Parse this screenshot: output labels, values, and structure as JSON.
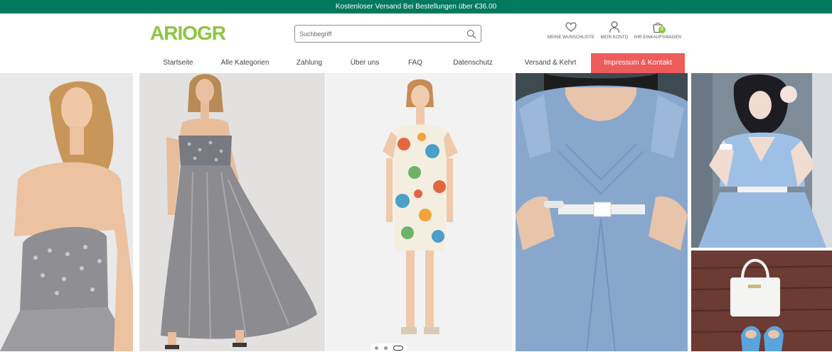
{
  "promo_bar": {
    "text": "Kostenloser Versand Bei Bestellungen über €36.00"
  },
  "header": {
    "logo": "ARIOGR",
    "search": {
      "placeholder": "Suchbegriff",
      "value": ""
    },
    "actions": {
      "wishlist": {
        "label": "MEINE WUNSCHLISTE",
        "icon": "heart-icon"
      },
      "account": {
        "label": "MEIN KONTO",
        "icon": "user-icon"
      },
      "cart": {
        "label": "IHR EINKAUFSWAGEN",
        "count": "0",
        "icon": "shopping-bag-icon"
      }
    }
  },
  "nav": {
    "items": [
      {
        "label": "Startseite"
      },
      {
        "label": "Alle Kategorien "
      },
      {
        "label": "Zahlung"
      },
      {
        "label": "Über uns"
      },
      {
        "label": "FAQ"
      },
      {
        "label": "Datenschutz"
      },
      {
        "label": "Versand & Kehrt"
      },
      {
        "label": "Impressum & Kontakt",
        "active": true
      }
    ]
  },
  "carousel": {
    "slide_count": 3,
    "active_index": 2
  },
  "colors": {
    "promo_bg": "#00795f",
    "brand_green": "#8cc63f",
    "active_nav": "#ee5b5b"
  }
}
